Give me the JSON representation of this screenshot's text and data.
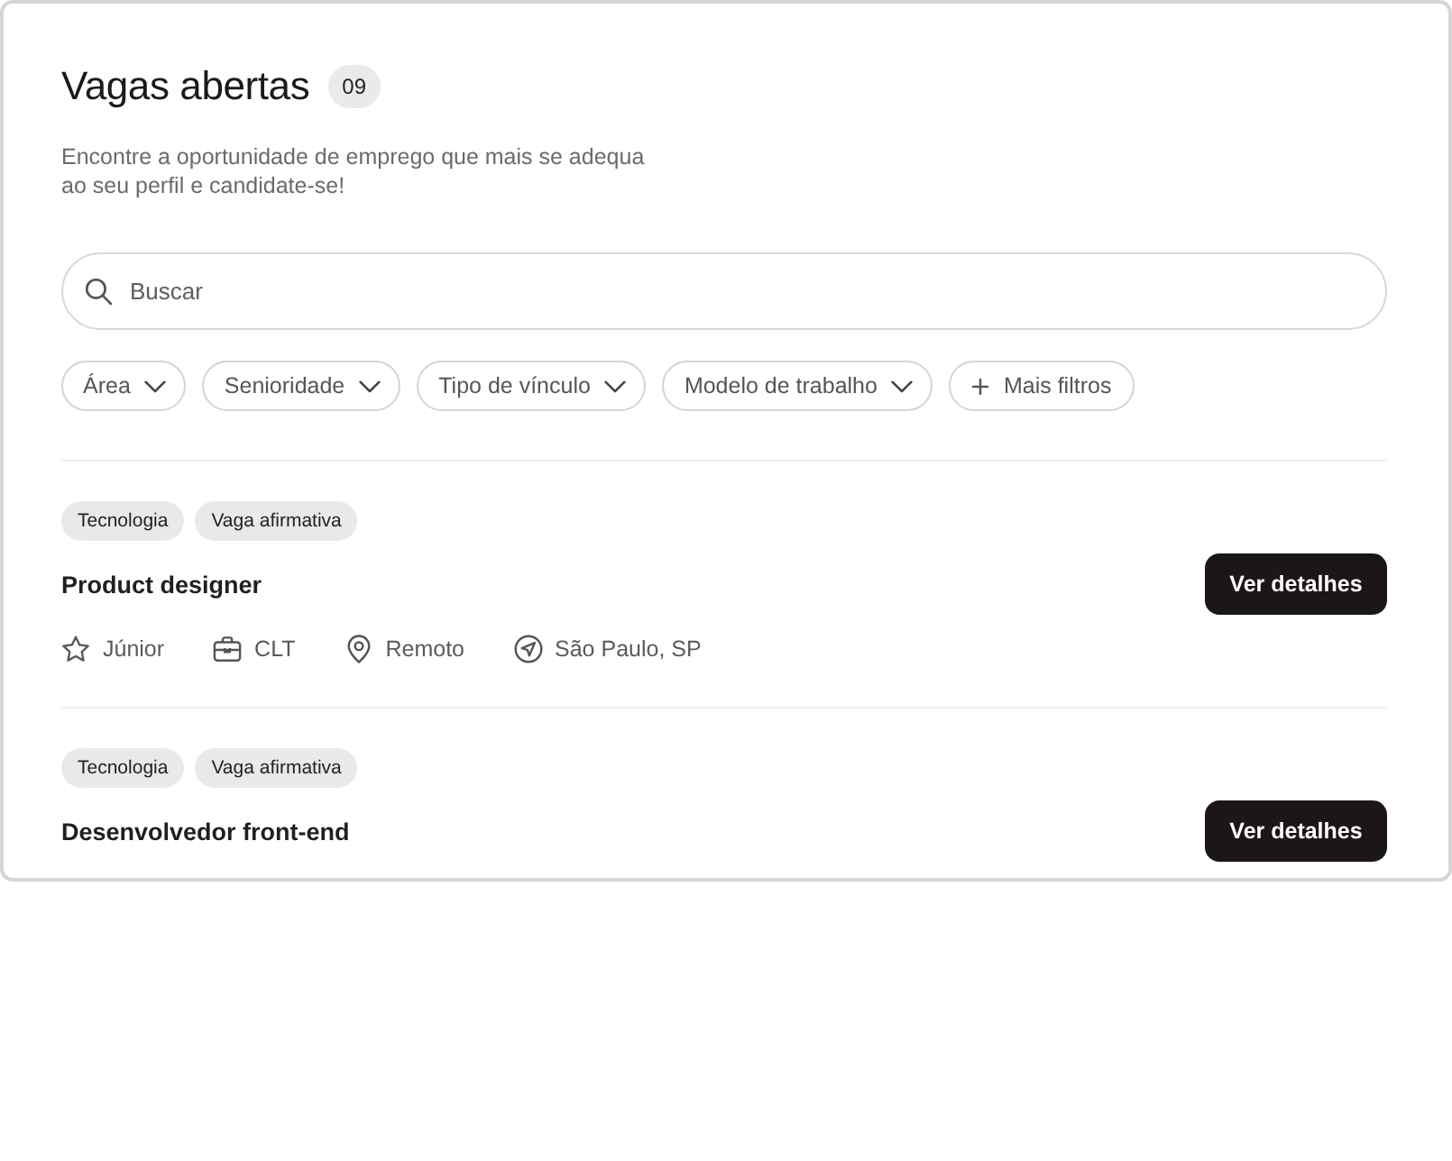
{
  "header": {
    "title": "Vagas abertas",
    "count": "09",
    "description": "Encontre a oportunidade de emprego que mais se adequa ao seu perfil e candidate-se!"
  },
  "search": {
    "placeholder": "Buscar"
  },
  "filters": [
    {
      "label": "Área",
      "kind": "dropdown"
    },
    {
      "label": "Senioridade",
      "kind": "dropdown"
    },
    {
      "label": "Tipo de vínculo",
      "kind": "dropdown"
    },
    {
      "label": "Modelo de trabalho",
      "kind": "dropdown"
    },
    {
      "label": "Mais filtros",
      "kind": "add"
    }
  ],
  "jobs": [
    {
      "tags": [
        "Tecnologia",
        "Vaga afirmativa"
      ],
      "title": "Product designer",
      "button": "Ver detalhes",
      "details": [
        {
          "kind": "seniority",
          "text": "Júnior"
        },
        {
          "kind": "contract",
          "text": "CLT"
        },
        {
          "kind": "work_model",
          "text": "Remoto"
        },
        {
          "kind": "city",
          "text": "São Paulo, SP"
        }
      ]
    },
    {
      "tags": [
        "Tecnologia",
        "Vaga afirmativa"
      ],
      "title": "Desenvolvedor front-end",
      "button": "Ver detalhes"
    }
  ]
}
